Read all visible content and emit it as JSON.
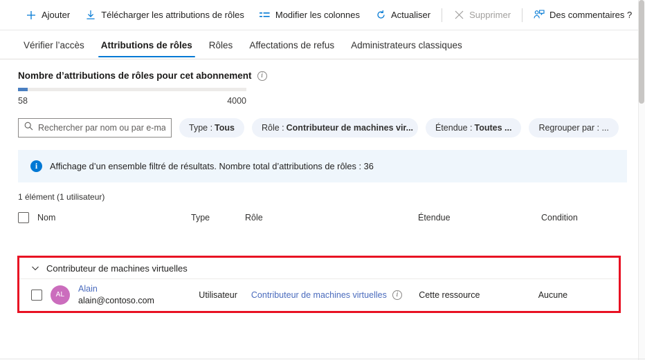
{
  "toolbar": {
    "items": [
      {
        "label": "Ajouter",
        "icon": "plus-icon",
        "disabled": false
      },
      {
        "label": "Télécharger les attributions de rôles",
        "icon": "download-icon",
        "disabled": false
      },
      {
        "label": "Modifier les colonnes",
        "icon": "columns-icon",
        "disabled": false
      },
      {
        "label": "Actualiser",
        "icon": "refresh-icon",
        "disabled": false
      },
      {
        "label": "Supprimer",
        "icon": "close-icon",
        "disabled": true
      },
      {
        "label": "Des commentaires ?",
        "icon": "feedback-icon",
        "disabled": false
      }
    ]
  },
  "tabs": [
    {
      "label": "Vérifier l’accès",
      "active": false
    },
    {
      "label": "Attributions de rôles",
      "active": true
    },
    {
      "label": "Rôles",
      "active": false
    },
    {
      "label": "Affectations de refus",
      "active": false
    },
    {
      "label": "Administrateurs classiques",
      "active": false
    }
  ],
  "quota": {
    "title": "Nombre d’attributions de rôles pour cet abonnement",
    "current": "58",
    "max": "4000",
    "percent": 4.2,
    "fill_color": "#4a7fc1"
  },
  "search": {
    "placeholder": "Rechercher par nom ou par e-mail",
    "value": ""
  },
  "filters": [
    {
      "prefix": "Type :",
      "value": "Tous"
    },
    {
      "prefix": "Rôle :",
      "value": "Contributeur de machines vir..."
    },
    {
      "prefix": "Étendue :",
      "value": "Toutes ..."
    },
    {
      "prefix": "Regrouper par : ...",
      "value": ""
    }
  ],
  "banner": {
    "text": "Affichage d’un ensemble filtré de résultats. Nombre total d’attributions de rôles : 36",
    "background": "#eff6fc",
    "accent": "#0078d4"
  },
  "table": {
    "count_label": "1 élément (1 utilisateur)",
    "columns": [
      "Nom",
      "Type",
      "Rôle",
      "Étendue",
      "Condition"
    ],
    "group": {
      "label": "Contributeur de machines virtuelles",
      "expanded": true
    },
    "rows": [
      {
        "initials": "AL",
        "avatar_color": "#cb6dbd",
        "name": "Alain",
        "email": "alain@contoso.com",
        "type": "Utilisateur",
        "role": "Contributeur de machines virtuelles",
        "scope": "Cette ressource",
        "condition": "Aucune"
      }
    ]
  },
  "highlight": {
    "color": "#e81123"
  }
}
